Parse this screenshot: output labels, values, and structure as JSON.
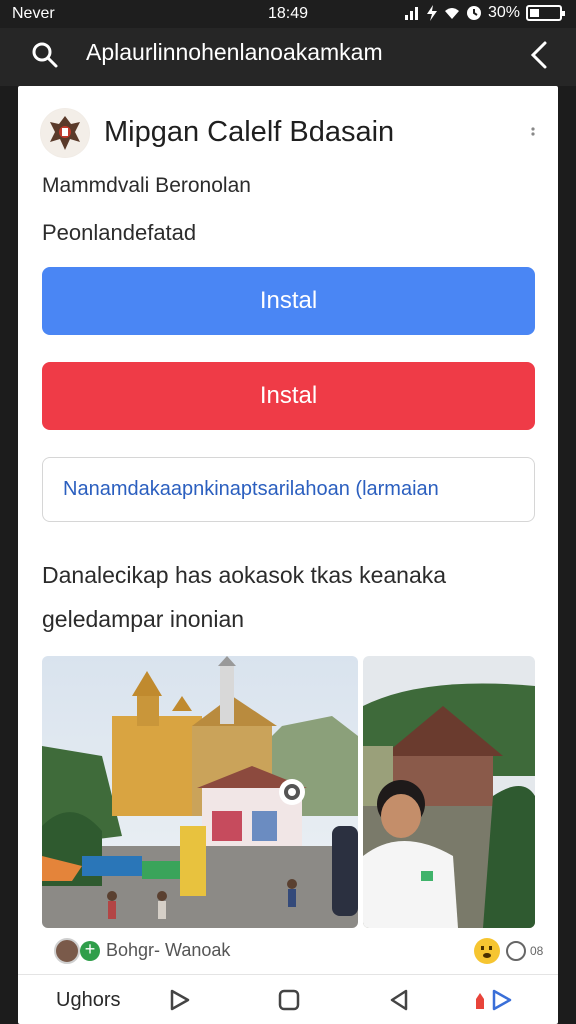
{
  "status_bar": {
    "carrier": "Never",
    "time": "18:49",
    "battery": "30%"
  },
  "app_bar": {
    "title": "Aplaurlinnohenlanoakamkam",
    "search_icon": "search-icon",
    "back_icon": "chevron-left-icon"
  },
  "app": {
    "name": "Mipgan Calelf Bdasain",
    "developer": "Mammdvali Beronolan",
    "category": "Peonlandefatad"
  },
  "buttons": {
    "install_primary": "Instal",
    "install_secondary": "Instal",
    "outline_link": "Nanamdakaapnkinaptsarilahoan (larmaian"
  },
  "description": {
    "line1": "Danalecikap has aokasok tkas keanaka",
    "line2": "geledampar inonian"
  },
  "review": {
    "reviewer": "Bohgr- Wanoak",
    "count": "08"
  },
  "bottom_nav": {
    "label": "Ughors",
    "icons": [
      "play-icon",
      "square-icon",
      "back-triangle-icon",
      "share-icon"
    ]
  },
  "colors": {
    "install_blue": "#4a86f4",
    "install_red": "#ef3b47",
    "link_blue": "#2b5fbf",
    "app_bar": "#262626"
  }
}
